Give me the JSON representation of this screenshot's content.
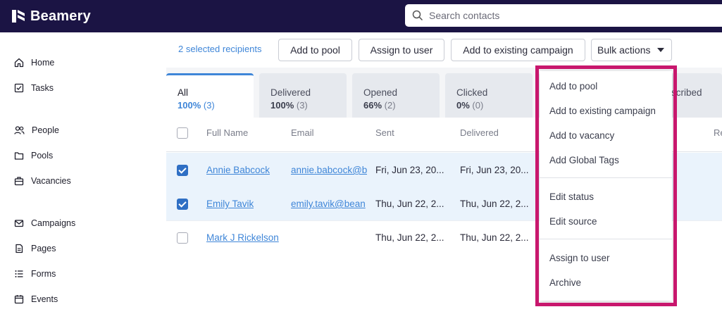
{
  "app": {
    "name": "Beamery"
  },
  "search": {
    "placeholder": "Search contacts"
  },
  "sidebar": {
    "items": [
      {
        "label": "Home",
        "icon": "home-icon"
      },
      {
        "label": "Tasks",
        "icon": "tasks-icon"
      },
      {
        "label": "People",
        "icon": "people-icon"
      },
      {
        "label": "Pools",
        "icon": "folder-icon"
      },
      {
        "label": "Vacancies",
        "icon": "briefcase-icon"
      },
      {
        "label": "Campaigns",
        "icon": "mail-icon"
      },
      {
        "label": "Pages",
        "icon": "page-icon"
      },
      {
        "label": "Forms",
        "icon": "list-icon"
      },
      {
        "label": "Events",
        "icon": "calendar-icon"
      }
    ]
  },
  "toolbar": {
    "selected_text": "2 selected recipients",
    "add_to_pool": "Add to pool",
    "assign_to_user": "Assign to user",
    "add_to_existing_campaign": "Add to existing campaign",
    "bulk_actions": "Bulk actions"
  },
  "tabs": [
    {
      "label": "All",
      "pct": "100%",
      "count": "(3)",
      "active": true
    },
    {
      "label": "Delivered",
      "pct": "100%",
      "count": "(3)"
    },
    {
      "label": "Opened",
      "pct": "66%",
      "count": "(2)"
    },
    {
      "label": "Clicked",
      "pct": "0%",
      "count": "(0)"
    },
    {
      "label_visible_fragment": "scribed"
    }
  ],
  "table": {
    "columns": [
      "Full Name",
      "Email",
      "Sent",
      "Delivered",
      "Re"
    ],
    "rows": [
      {
        "checked": true,
        "name": "Annie Babcock",
        "email": "annie.babcock@b",
        "sent": "Fri, Jun 23, 20...",
        "delivered": "Fri, Jun 23, 20..."
      },
      {
        "checked": true,
        "name": "Emily Tavik",
        "email": "emily.tavik@bean",
        "sent": "Thu, Jun 22, 2...",
        "delivered": "Thu, Jun 22, 2..."
      },
      {
        "checked": false,
        "name": "Mark J Rickelson",
        "email": "",
        "sent": "Thu, Jun 22, 2...",
        "delivered": "Thu, Jun 22, 2..."
      }
    ]
  },
  "bulk_menu": {
    "items": [
      "Add to pool",
      "Add to existing campaign",
      "Add to vacancy",
      "Add Global Tags",
      "Edit status",
      "Edit source",
      "Assign to user",
      "Archive"
    ]
  },
  "colors": {
    "topbar": "#1b1444",
    "accent": "#3f86d8",
    "highlight": "#c8176d",
    "checkbox": "#2f6fc4"
  }
}
